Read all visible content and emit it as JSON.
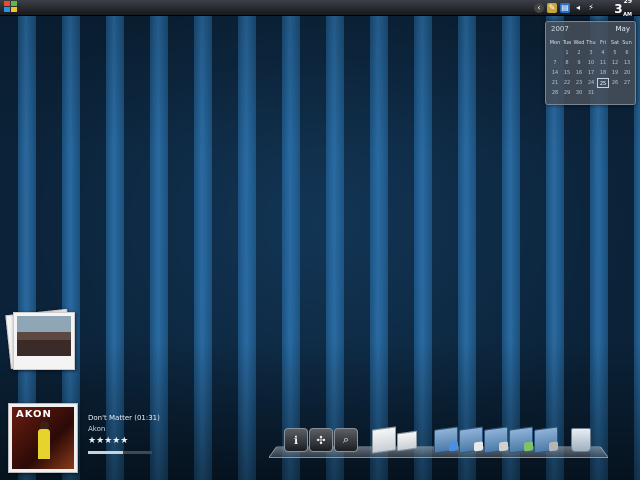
{
  "taskbar": {
    "clock_hour": "3",
    "clock_minute": "29",
    "clock_ampm": "AM"
  },
  "calendar": {
    "year": "2007",
    "month": "May",
    "weekdays": [
      "Mon",
      "Tue",
      "Wed",
      "Thu",
      "Fri",
      "Sat",
      "Sun"
    ],
    "days": [
      "",
      "1",
      "2",
      "3",
      "4",
      "5",
      "6",
      "7",
      "8",
      "9",
      "10",
      "11",
      "12",
      "13",
      "14",
      "15",
      "16",
      "17",
      "18",
      "19",
      "20",
      "21",
      "22",
      "23",
      "24",
      "25",
      "26",
      "27",
      "28",
      "29",
      "30",
      "31",
      "",
      "",
      ""
    ],
    "today": "25"
  },
  "media": {
    "album_logo": "AKON",
    "song": "Don't Matter (01:31)",
    "artist": "Akon",
    "rating_stars": "★★★★★",
    "progress": 0.55
  },
  "dock": {
    "items": [
      "info-icon",
      "compass-icon",
      "search-icon",
      "document-icon",
      "notes-icon",
      "computer-folder-icon",
      "documents-folder-icon",
      "music-folder-icon",
      "pictures-folder-icon",
      "applications-folder-icon",
      "trash-icon"
    ]
  }
}
